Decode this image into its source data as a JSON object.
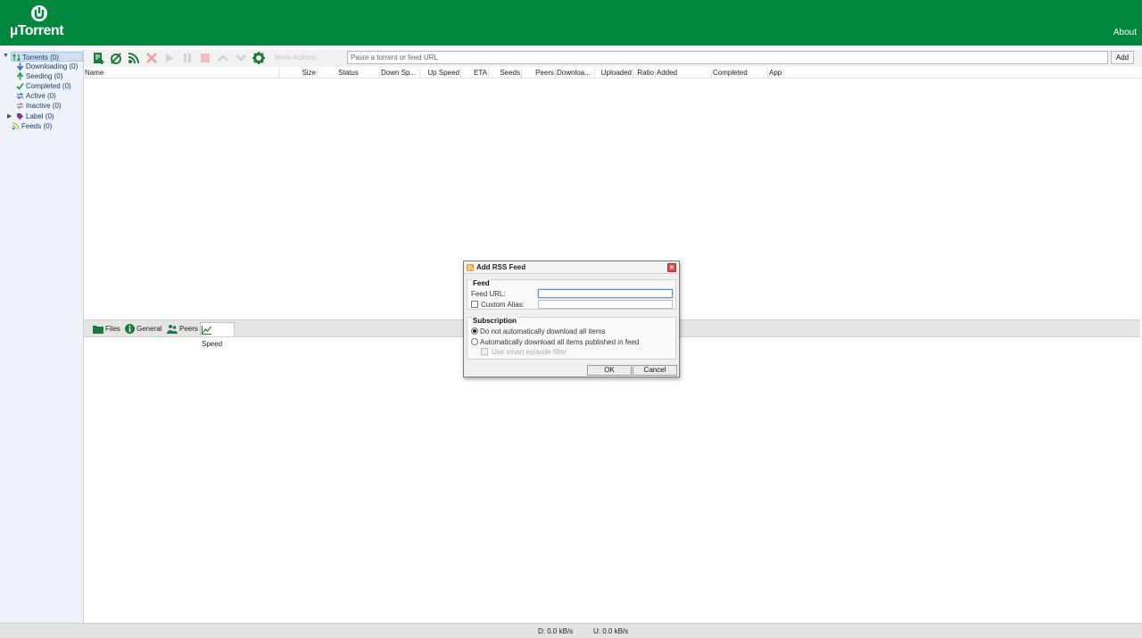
{
  "header": {
    "logo_text": "µTorrent",
    "about_label": "About",
    "brand_color": "#00873d"
  },
  "sidebar": {
    "items": [
      {
        "label": "Torrents (0)",
        "icon": "torrents-icon"
      },
      {
        "label": "Downloading (0)",
        "icon": "download-arrow-icon"
      },
      {
        "label": "Seeding (0)",
        "icon": "seeding-icon"
      },
      {
        "label": "Completed (0)",
        "icon": "checkmark-icon"
      },
      {
        "label": "Active (0)",
        "icon": "active-arrows-icon"
      },
      {
        "label": "Inactive (0)",
        "icon": "inactive-arrows-icon"
      },
      {
        "label": "Label (0)",
        "icon": "label-tag-icon"
      },
      {
        "label": "Feeds (0)",
        "icon": "rss-feed-icon"
      }
    ]
  },
  "toolbar": {
    "more_actions_label": "More Actions",
    "url_placeholder": "Paste a torrent or feed URL",
    "add_label": "Add",
    "icons": [
      "add-torrent-icon",
      "create-torrent-icon",
      "add-rss-feed-icon",
      "remove-icon",
      "start-icon",
      "pause-icon",
      "stop-icon",
      "move-up-icon",
      "move-down-icon",
      "settings-gear-icon"
    ]
  },
  "columns": [
    "Name",
    "Size",
    "Status",
    "Down Sp...",
    "Up Speed",
    "ETA",
    "Seeds",
    "Peers",
    "Downloa...",
    "Uploaded",
    "Ratio",
    "Added",
    "Completed",
    "App"
  ],
  "tabs": [
    {
      "label": "Files",
      "icon": "folder-icon"
    },
    {
      "label": "General",
      "icon": "info-icon"
    },
    {
      "label": "Peers",
      "icon": "peers-icon"
    },
    {
      "label": "Speed",
      "icon": "speed-chart-icon"
    }
  ],
  "status": {
    "download": "D: 0.0 kB/s",
    "upload": "U: 0.0 kB/s"
  },
  "dialog": {
    "title": "Add RSS Feed",
    "feed_group": "Feed",
    "feed_url_label": "Feed URL:",
    "custom_alias_label": "Custom Alias:",
    "subscription_group": "Subscription",
    "option_no_auto": "Do not automatically download all items",
    "option_auto": "Automatically download all items published in feed",
    "smart_filter_label": "Use smart episode filter",
    "ok_label": "OK",
    "cancel_label": "Cancel"
  }
}
